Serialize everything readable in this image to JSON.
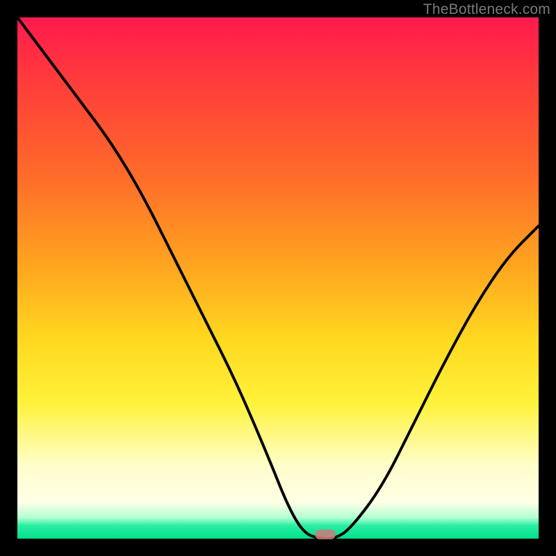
{
  "watermark": {
    "text": "TheBottleneck.com"
  },
  "chart_data": {
    "type": "line",
    "title": "",
    "xlabel": "",
    "ylabel": "",
    "xlim": [
      0,
      100
    ],
    "ylim": [
      0,
      100
    ],
    "series": [
      {
        "name": "bottleneck-curve",
        "x": [
          0,
          6,
          12,
          18,
          24,
          30,
          36,
          42,
          48,
          52,
          55,
          58,
          61,
          64,
          70,
          76,
          82,
          88,
          94,
          100
        ],
        "y": [
          100,
          92,
          84,
          76,
          66,
          54,
          42,
          30,
          16,
          6,
          1,
          0,
          0,
          2,
          10,
          22,
          34,
          45,
          54,
          60
        ]
      }
    ],
    "annotations": [
      {
        "name": "optimal-marker",
        "x": 59,
        "y": 0.8
      }
    ],
    "background_gradient": {
      "stops": [
        {
          "pos": 0,
          "color": "#ff1a4d"
        },
        {
          "pos": 0.48,
          "color": "#ffa61f"
        },
        {
          "pos": 0.74,
          "color": "#fff23a"
        },
        {
          "pos": 0.93,
          "color": "#ffffe6"
        },
        {
          "pos": 1.0,
          "color": "#00e08a"
        }
      ]
    }
  }
}
